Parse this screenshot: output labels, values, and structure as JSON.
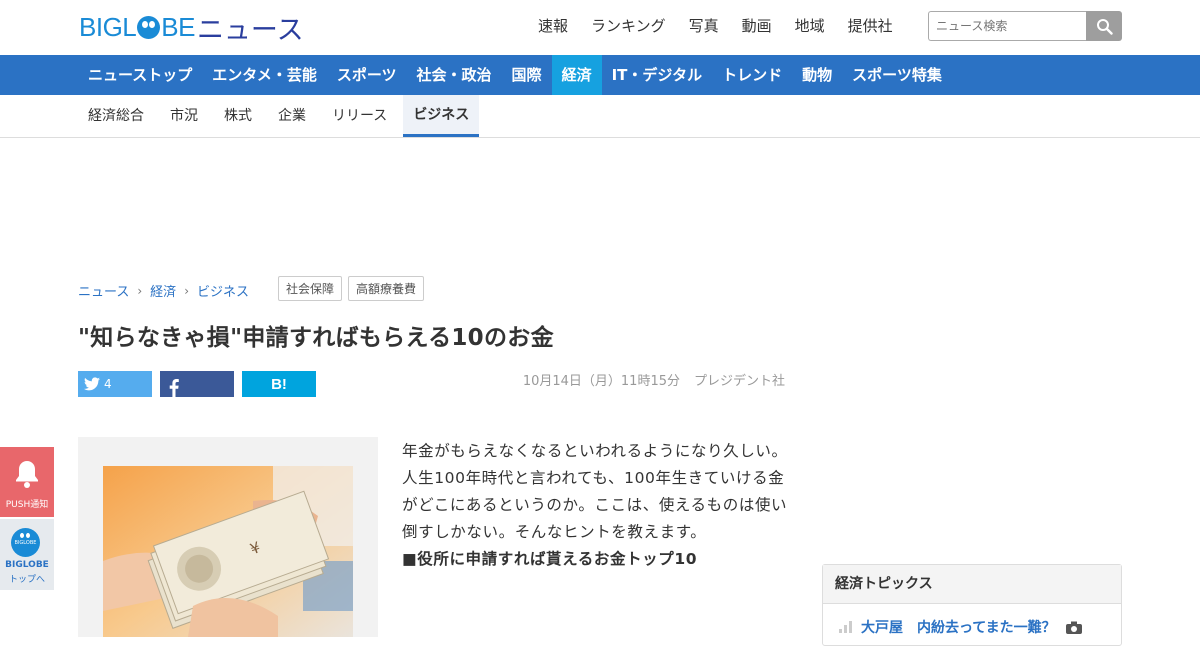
{
  "header": {
    "logo_text": "BIGLOBE",
    "logo_news": "ニュース",
    "top_links": [
      "速報",
      "ランキング",
      "写真",
      "動画",
      "地域",
      "提供社"
    ],
    "search_placeholder": "ニュース検索"
  },
  "nav": {
    "items": [
      "ニューストップ",
      "エンタメ・芸能",
      "スポーツ",
      "社会・政治",
      "国際",
      "経済",
      "IT・デジタル",
      "トレンド",
      "動物",
      "スポーツ特集"
    ],
    "active": "経済"
  },
  "subnav": {
    "items": [
      "経済総合",
      "市況",
      "株式",
      "企業",
      "リリース",
      "ビジネス"
    ],
    "active": "ビジネス"
  },
  "breadcrumb": [
    "ニュース",
    "経済",
    "ビジネス"
  ],
  "tags": [
    "社会保障",
    "高額療養費"
  ],
  "article": {
    "title": "\"知らなきゃ損\"申請すればもらえる10のお金",
    "twitter_count": "4",
    "hatena_label": "B!",
    "date": "10月14日（月）11時15分",
    "source": "プレジデント社",
    "lead": "年金がもらえなくなるといわれるようになり久しい。人生100年時代と言われても、100年生きていける金がどこにあるというのか。ここは、使えるものは使い倒すしかない。そんなヒントを教えます。",
    "subhead": "■役所に申請すれば貰えるお金トップ10"
  },
  "side": {
    "push_label": "PUSH通知",
    "biglobe_label": "BIGLOBE",
    "top_label": "トップへ",
    "mini_logo": "BIGLOBE"
  },
  "topics": {
    "heading": "経済トピックス",
    "first_item": "大戸屋　内紛去ってまた一難？"
  },
  "colors": {
    "nav_bg": "#2b72c4",
    "nav_active": "#16a1e0",
    "logo_blue": "#1a8bd6",
    "push_red": "#e8676b"
  }
}
